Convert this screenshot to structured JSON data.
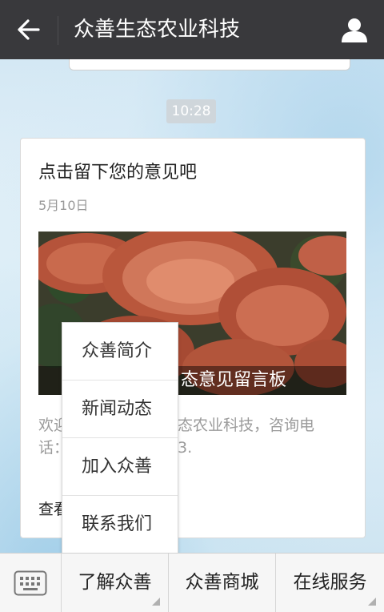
{
  "header": {
    "title": "众善生态农业科技"
  },
  "chat": {
    "time": "10:28",
    "message": {
      "title": "点击留下您的意见吧",
      "date": "5月10日",
      "cover_caption": "态意见留言板",
      "description_visible_parts": [
        "欢迎",
        "话：",
        "态农业科技，咨询电",
        "3."
      ],
      "read_more": "查看"
    }
  },
  "popup_menu": {
    "items": [
      "众善简介",
      "新闻动态",
      "加入众善",
      "联系我们"
    ]
  },
  "bottom_menu": {
    "keyboard_icon": "keyboard-icon",
    "tabs": [
      "了解众善",
      "众善商城",
      "在线服务"
    ]
  },
  "colors": {
    "header_bg": "#39393c",
    "bottom_bg": "#f6f6f6",
    "chat_bg": "#dcecf6"
  }
}
